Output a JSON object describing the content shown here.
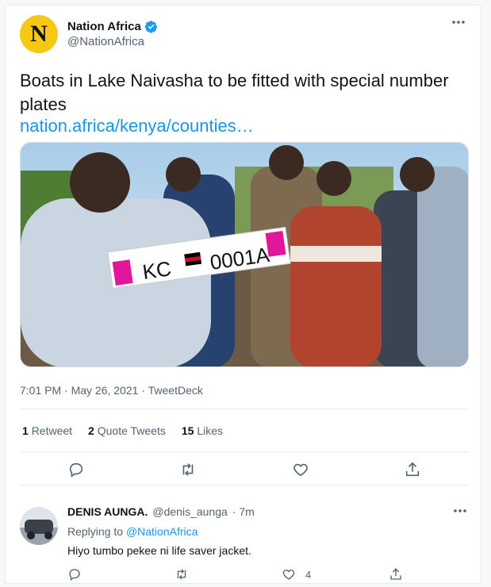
{
  "tweet": {
    "author_name": "Nation Africa",
    "author_handle": "@NationAfrica",
    "avatar_letter": "N",
    "text": "Boats in Lake Naivasha to be fitted with special number plates",
    "link": "nation.africa/kenya/counties…",
    "photo_plate_left": "KC",
    "photo_plate_right": "0001A",
    "timestamp": "7:01 PM · May 26, 2021 · TweetDeck",
    "stats": {
      "retweets_count": "1",
      "retweets_label": "Retweet",
      "quotes_count": "2",
      "quotes_label": "Quote Tweets",
      "likes_count": "15",
      "likes_label": "Likes"
    }
  },
  "reply": {
    "author_name": "DENIS AUNGA.",
    "author_handle": "@denis_aunga",
    "time": "· 7m",
    "replying_prefix": "Replying to",
    "replying_handle": "@NationAfrica",
    "text": "Hiyo tumbo pekee ni life saver jacket.",
    "likes_count": "4"
  },
  "colors": {
    "accent": "#1b95e0",
    "avatar_bg": "#f6c813",
    "muted": "#536471"
  }
}
